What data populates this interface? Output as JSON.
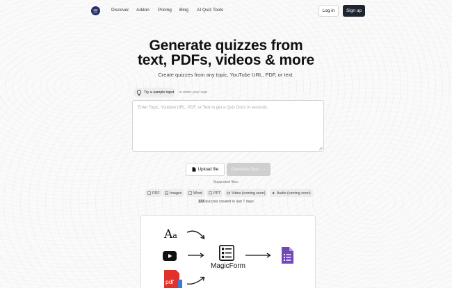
{
  "header": {
    "nav": [
      "Discover",
      "Addon",
      "Pricing",
      "Blog",
      "AI Quiz Tools"
    ],
    "login_label": "Log in",
    "signup_label": "Sign up"
  },
  "hero": {
    "title_line1": "Generate quizzes from",
    "title_line2": "text, PDFs, videos & more",
    "subtitle": "Create quizzes from any topic, YouTube URL, PDF, or text."
  },
  "input": {
    "sample_label": "Try a sample input",
    "or_text": "or enter your own",
    "placeholder": "Enter Topic, Youtube URL, PDF, or Text to get a Quiz Docs in seconds."
  },
  "actions": {
    "upload_label": "Upload file",
    "generate_label": "Generate Quiz"
  },
  "supported": {
    "label": "Supported files:",
    "types": [
      {
        "label": "PDF",
        "icon": "pdf-file-icon"
      },
      {
        "label": "Images",
        "icon": "image-icon"
      },
      {
        "label": "Word",
        "icon": "word-file-icon"
      },
      {
        "label": "PPT",
        "icon": "ppt-file-icon"
      },
      {
        "label": "Video (coming soon)",
        "icon": "video-icon"
      },
      {
        "label": "Audio (coming soon)",
        "icon": "audio-icon"
      }
    ]
  },
  "stats": {
    "count": "333",
    "text": "quizzes created in last 7 days"
  },
  "diagram": {
    "label": "MagicForm",
    "pdf_text": "pdf"
  },
  "colors": {
    "brand": "#2b2f6b",
    "signup_bg": "#1e2530",
    "generate_disabled": "#cfcfcf",
    "youtube_red": "#000000",
    "pdf_red": "#e0322b",
    "forms_purple": "#7248b9"
  }
}
